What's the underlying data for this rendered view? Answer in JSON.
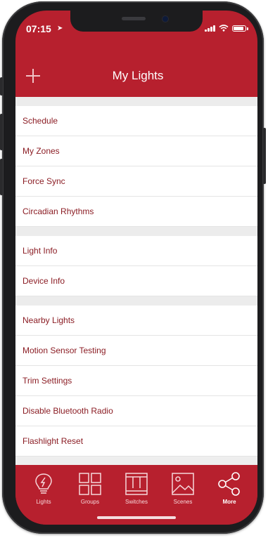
{
  "status_bar": {
    "time": "07:15",
    "location_arrow": "➤"
  },
  "header": {
    "title": "My Lights",
    "add_icon": "plus-icon"
  },
  "menu_groups": [
    {
      "items": [
        "Schedule",
        "My Zones",
        "Force Sync",
        "Circadian Rhythms"
      ]
    },
    {
      "items": [
        "Light Info",
        "Device Info"
      ]
    },
    {
      "items": [
        "Nearby Lights",
        "Motion Sensor Testing",
        "Trim Settings",
        "Disable Bluetooth Radio",
        "Flashlight Reset"
      ]
    }
  ],
  "tabs": [
    {
      "label": "Lights",
      "icon": "lightbulb-icon"
    },
    {
      "label": "Groups",
      "icon": "grid-icon"
    },
    {
      "label": "Switches",
      "icon": "switches-icon"
    },
    {
      "label": "Scenes",
      "icon": "image-icon"
    },
    {
      "label": "More",
      "icon": "share-icon",
      "active": true
    }
  ],
  "colors": {
    "brand": "#b7202e",
    "item_text": "#8b1d24",
    "background": "#eeeeee"
  }
}
